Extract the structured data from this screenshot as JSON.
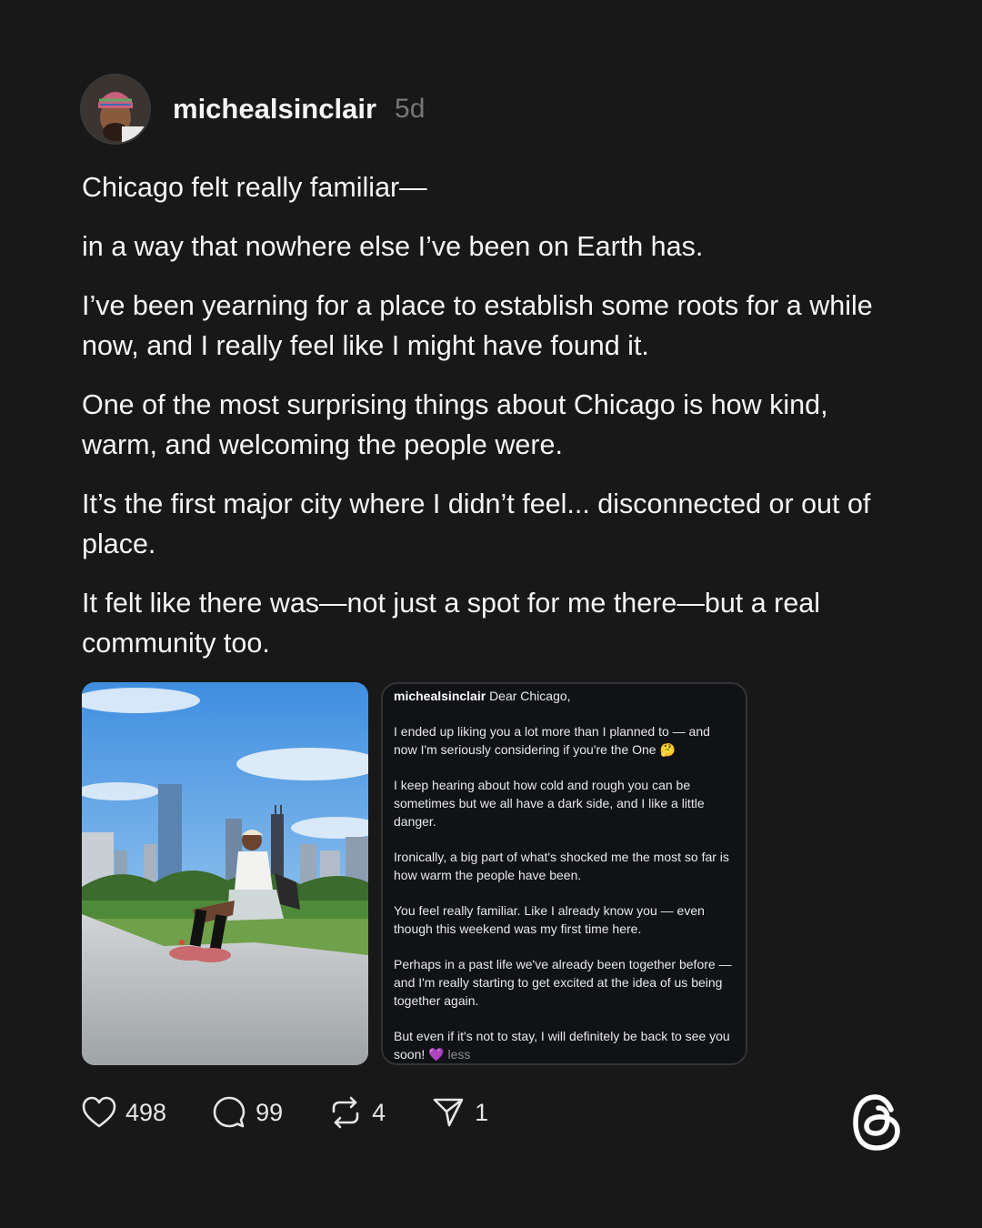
{
  "post": {
    "username": "michealsinclair",
    "time": "5d",
    "paragraphs": [
      "Chicago felt really familiar—",
      "in a way that nowhere else I’ve been on Earth has.",
      "I’ve been yearning for a place to establish some roots for a while now, and I really feel like I might have found it.",
      "One of the most surprising things about Chicago is how kind, warm, and welcoming the people were.",
      "It’s the first major city where I didn’t feel... disconnected or out of place.",
      "It felt like there was—not just a spot for me there—but a real community too."
    ]
  },
  "caption_card": {
    "username": "michealsinclair",
    "first_line": "Dear Chicago,",
    "paragraphs": [
      "I ended up liking you a lot more than I planned to — and now I'm seriously considering if you're the One 🤔",
      "I keep hearing about how cold and rough you can be sometimes but we all have a dark side, and I like a little danger.",
      "Ironically, a big part of what's shocked me the most so far is how warm the people have been.",
      "You feel really familiar. Like I already know you — even though this weekend was my first time here.",
      "Perhaps in a past life we've already been together before — and I'm really starting to get excited at the idea of us being together again."
    ],
    "last_paragraph": "But even if it's not to stay, I will definitely be back to see you soon! 💜",
    "less_label": "less"
  },
  "actions": {
    "likes": "498",
    "comments": "99",
    "reposts": "4",
    "shares": "1"
  },
  "icons": [
    "heart-icon",
    "comment-icon",
    "repost-icon",
    "share-icon",
    "threads-logo-icon"
  ],
  "colors": {
    "background": "#181818",
    "text": "#f3f5f7",
    "muted": "#777777"
  }
}
